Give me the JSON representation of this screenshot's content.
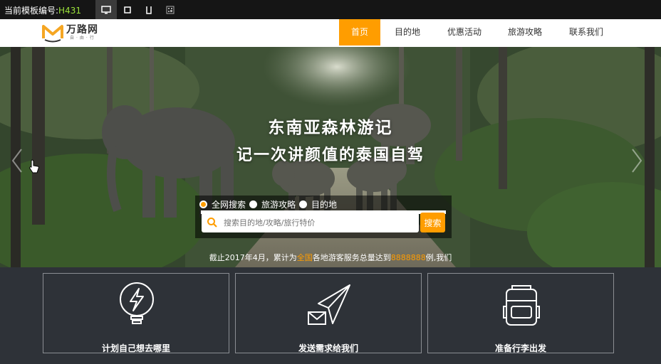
{
  "topbar": {
    "template_label": "当前模板编号:",
    "template_code": "H431",
    "devices": [
      "desktop-icon",
      "tablet-icon",
      "phone-icon",
      "qrcode-icon"
    ]
  },
  "logo": {
    "name": "万路网",
    "tagline": "自·由·行"
  },
  "nav": {
    "items": [
      {
        "label": "首页",
        "active": true
      },
      {
        "label": "目的地"
      },
      {
        "label": "优惠活动"
      },
      {
        "label": "旅游攻略"
      },
      {
        "label": "联系我们"
      }
    ]
  },
  "hero": {
    "title": "东南亚森林游记",
    "subtitle": "记一次讲颜值的泰国自驾"
  },
  "search": {
    "options": [
      {
        "label": "全网搜索",
        "selected": true
      },
      {
        "label": "旅游攻略",
        "selected": false
      },
      {
        "label": "目的地",
        "selected": false
      }
    ],
    "placeholder": "搜索目的地/攻略/旅行特价",
    "button": "搜索"
  },
  "stat": {
    "prefix": "截止2017年4月，累计为",
    "highlight1": "全国",
    "middle": "各地游客服务总量达到",
    "highlight2": "8888888",
    "suffix": "例,我们"
  },
  "features": [
    {
      "label": "计划自己想去哪里",
      "icon": "lightbulb-icon"
    },
    {
      "label": "发送需求给我们",
      "icon": "paper-plane-icon"
    },
    {
      "label": "准备行李出发",
      "icon": "backpack-icon"
    }
  ],
  "colors": {
    "accent": "#ff9d00",
    "topbar": "#151515",
    "footer_bg": "#2e3238",
    "template_code": "#9be23a"
  }
}
